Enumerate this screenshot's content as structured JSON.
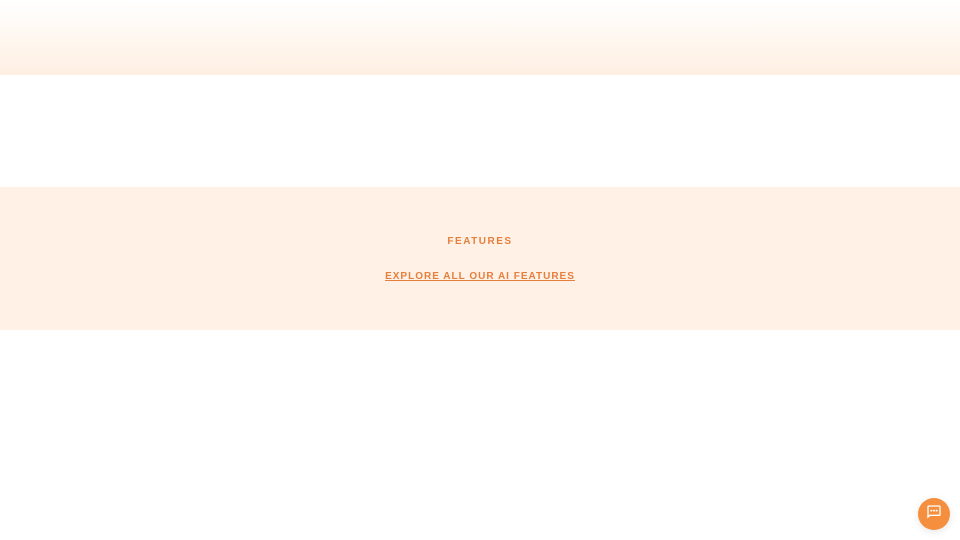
{
  "features": {
    "label": "FEATURES",
    "link_text": "EXPLORE ALL OUR AI FEATURES "
  },
  "colors": {
    "accent": "#e67e3c",
    "chat_button": "#f58f3d",
    "features_bg": "#fff1e6",
    "hero_gradient_end": "#ffefe2"
  }
}
